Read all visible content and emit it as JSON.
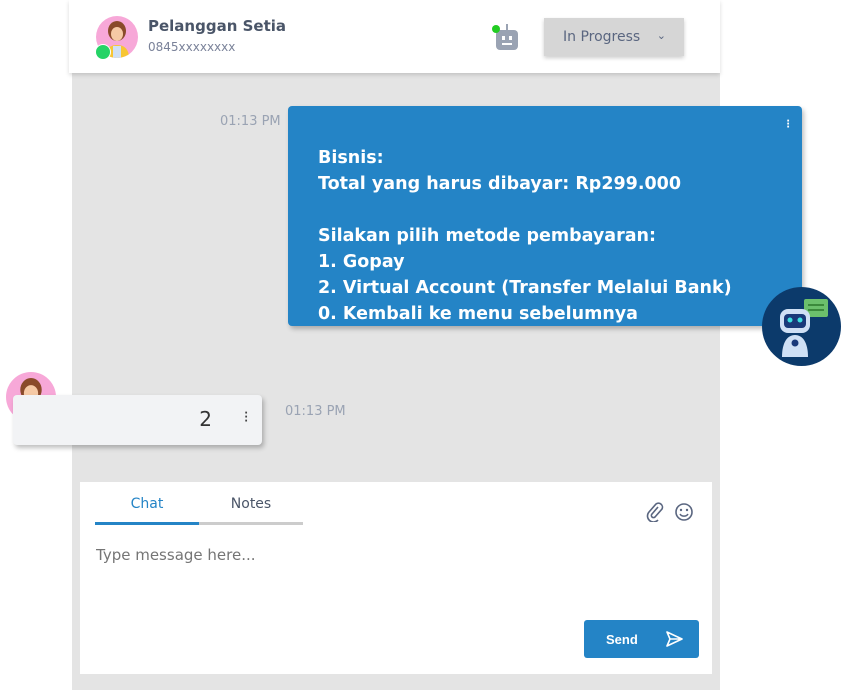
{
  "header": {
    "contact_name": "Pelanggan Setia",
    "contact_phone": "0845xxxxxxxx",
    "status": "In Progress",
    "status_chevron": "⌄"
  },
  "messages": [
    {
      "sender": "bot",
      "time": "01:13 PM",
      "text": "Bisnis:\nTotal yang harus dibayar: Rp299.000\n\nSilakan pilih metode pembayaran:\n1. Gopay\n2. Virtual Account (Transfer Melalui Bank)\n0. Kembali ke menu sebelumnya"
    },
    {
      "sender": "customer",
      "time": "01:13 PM",
      "text": "2"
    }
  ],
  "composer": {
    "tabs": [
      {
        "label": "Chat",
        "active": true
      },
      {
        "label": "Notes",
        "active": false
      }
    ],
    "placeholder": "Type message here...",
    "send_label": "Send"
  },
  "colors": {
    "accent": "#2484c6",
    "online": "#22cc22",
    "panel": "#e4e4e4"
  },
  "icons": [
    "whatsapp-icon",
    "robot-icon",
    "chevron-down-icon",
    "more-vertical-icon",
    "paperclip-icon",
    "emoji-icon",
    "send-icon"
  ]
}
